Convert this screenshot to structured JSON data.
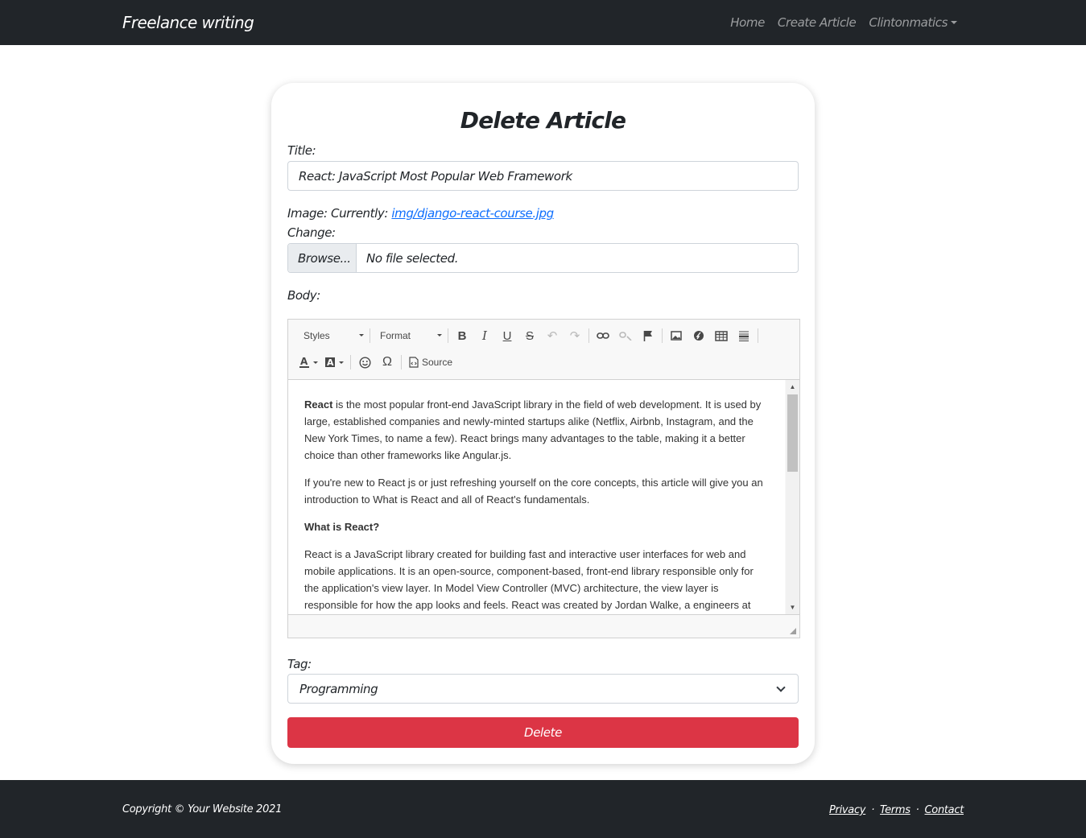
{
  "navbar": {
    "brand": "Freelance writing",
    "links": [
      "Home",
      "Create Article",
      "Clintonmatics"
    ]
  },
  "form": {
    "heading": "Delete Article",
    "title_label": "Title:",
    "title_value": "React: JavaScript Most Popular Web Framework",
    "image_label": "Image: Currently:",
    "image_current": "img/django-react-course.jpg",
    "change_label": "Change:",
    "browse_label": "Browse...",
    "file_status": "No file selected.",
    "body_label": "Body:",
    "tag_label": "Tag:",
    "tag_value": "Programming",
    "delete_label": "Delete"
  },
  "editor": {
    "styles_label": "Styles",
    "format_label": "Format",
    "source_label": "Source",
    "paragraphs": [
      {
        "bold": "React",
        "text": " is the most popular front-end JavaScript library in the field of web development. It is used by large, established companies and newly-minted startups alike (Netflix, Airbnb, Instagram, and the New York Times, to name a few). React brings many advantages to the table, making it a better choice than other frameworks like Angular.js."
      },
      {
        "bold": "",
        "text": "If you're new to React js or just refreshing yourself on the core concepts, this article will give you an introduction to What is React and all of React's fundamentals."
      },
      {
        "bold": "What is React?",
        "text": ""
      },
      {
        "bold": "",
        "text": "React is a JavaScript library created for building fast and interactive user interfaces for web and mobile applications. It is an open-source, component-based, front-end library responsible only for the application's view layer. In Model View Controller (MVC) architecture, the view layer is responsible for how the app looks and feels. React was created by Jordan Walke, a engineers  at Facebook."
      }
    ]
  },
  "footer": {
    "copyright": "Copyright © Your Website 2021",
    "links": [
      "Privacy",
      "Terms",
      "Contact"
    ],
    "separator": "·"
  },
  "colors": {
    "navbar_bg": "#212529",
    "danger": "#dc3545",
    "link": "#0d6efd"
  }
}
